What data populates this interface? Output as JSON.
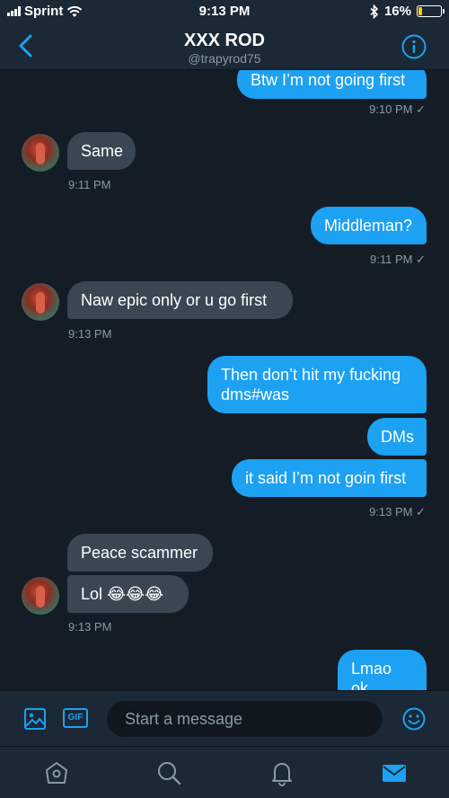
{
  "status_bar": {
    "carrier": "Sprint",
    "time": "9:13 PM",
    "battery": "16%",
    "battery_level": 0.16,
    "battery_color": "#ffcc00"
  },
  "header": {
    "title": "XXX ROD",
    "handle": "@trapyrod75"
  },
  "messages": {
    "m1": "Btw I’m not going first",
    "t1": "9:10 PM ✓",
    "m2": "Same",
    "t2": "9:11 PM",
    "m3": "Middleman?",
    "t3": "9:11 PM ✓",
    "m4": "Naw  epic only or u go first",
    "t4": "9:13 PM",
    "m5_line1": "Then don’t hit my fucking",
    "m5_line2": "dms#was",
    "m6": "DMs",
    "m7": "it said I’m not goin first",
    "t5": "9:13 PM ✓",
    "m8": "Peace scammer",
    "m9": "Lol 😂😂😂",
    "t6": "9:13 PM",
    "m10": "Lmao ok"
  },
  "composer": {
    "gif_label": "GIF",
    "placeholder": "Start a message"
  },
  "colors": {
    "background": "#141d26",
    "outgoing_bubble": "#1da1f2",
    "incoming_bubble": "#3a4753",
    "accent": "#1da1f2",
    "secondary_text": "#8899a6"
  },
  "tabs": [
    "home-icon",
    "search-icon",
    "notifications-icon",
    "messages-icon"
  ]
}
